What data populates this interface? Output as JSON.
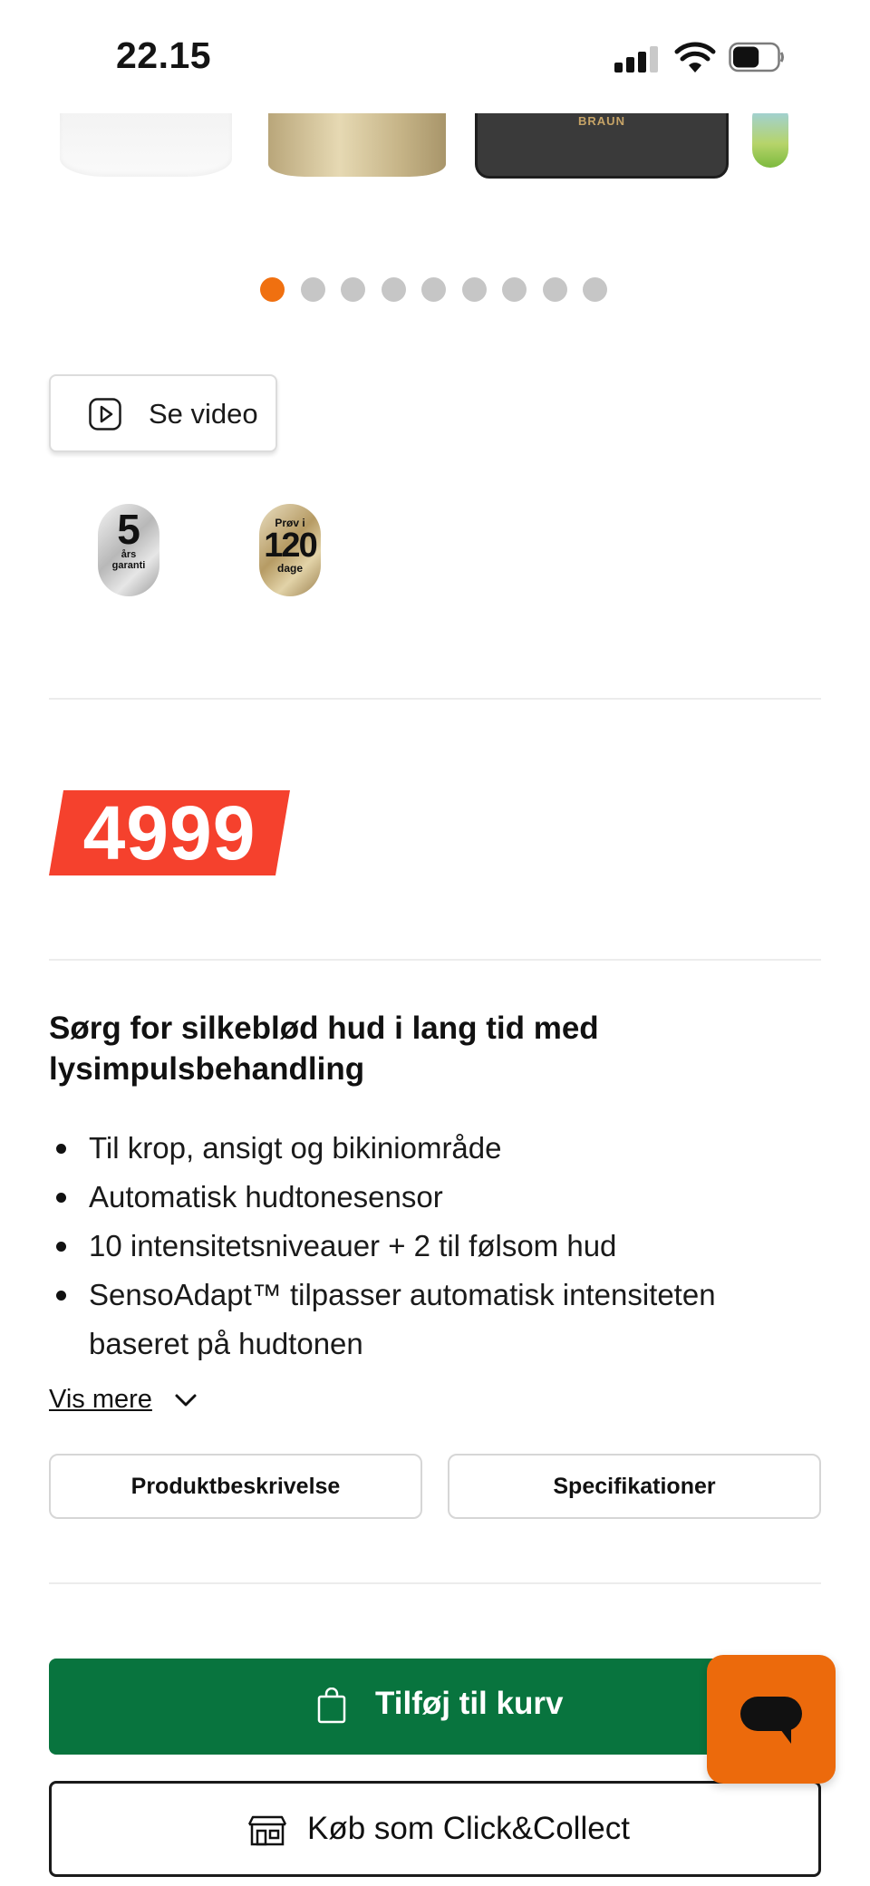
{
  "status_bar": {
    "time": "22.15",
    "battery_level": 0.6
  },
  "carousel": {
    "thumbnails": [
      {
        "name": "white-device"
      },
      {
        "name": "gold-device"
      },
      {
        "name": "storage-case",
        "brand": "BRAUN"
      },
      {
        "name": "green-attachment"
      }
    ],
    "page_count": 9,
    "active_index": 0
  },
  "video_button": {
    "label": "Se video",
    "icon": "play-icon"
  },
  "badges": {
    "warranty": {
      "number": "5",
      "line1": "års",
      "line2": "garanti"
    },
    "trial": {
      "top": "Prøv i",
      "number": "120",
      "bottom": "dage"
    }
  },
  "price": {
    "value": "4999"
  },
  "description": {
    "headline": "Sørg for silkeblød hud i lang tid med lysimpulsbehandling",
    "features": [
      "Til krop, ansigt og bikiniområde",
      "Automatisk hudtonesensor",
      "10 intensitetsniveauer + 2 til følsom hud",
      "SensoAdapt™ tilpasser automatisk intensiteten baseret på hudtonen"
    ],
    "more_label": "Vis mere"
  },
  "tabs": {
    "description_label": "Produktbeskrivelse",
    "specs_label": "Specifikationer"
  },
  "actions": {
    "add_to_cart_label": "Tilføj til kurv",
    "click_collect_label": "Køb som Click&Collect"
  },
  "colors": {
    "accent_orange": "#f07010",
    "cart_green": "#08743e",
    "price_red": "#f5412d",
    "chat_orange": "#ec6a0c"
  }
}
